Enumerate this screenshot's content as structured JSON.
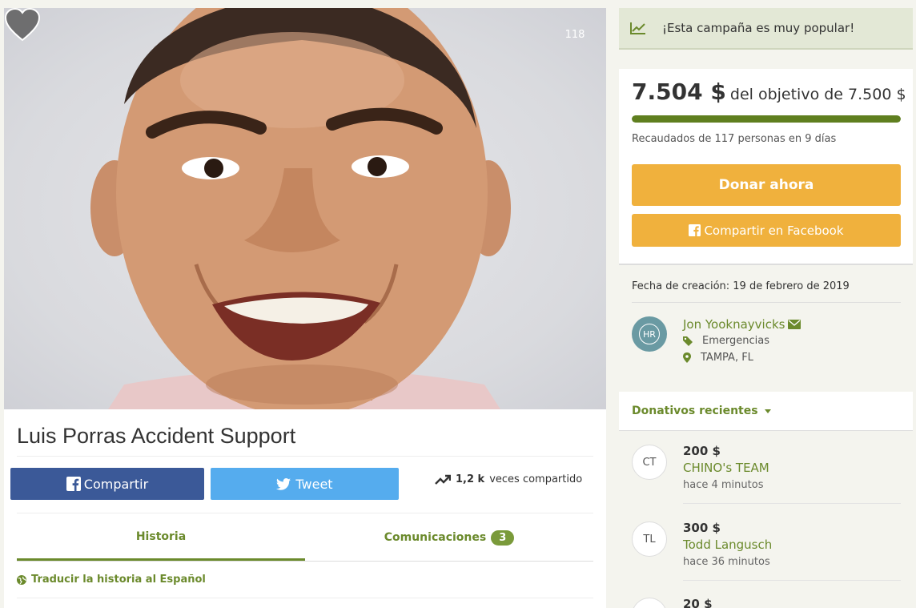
{
  "campaign": {
    "title": "Luis Porras Accident Support",
    "hearts": "118"
  },
  "share": {
    "facebook_label": "Compartir",
    "tweet_label": "Tweet",
    "shared_count": "1,2 k",
    "shared_label": "veces compartido"
  },
  "tabs": {
    "history": "Historia",
    "updates": "Comunicaciones",
    "updates_count": "3",
    "translate": "Traducir la historia al Español"
  },
  "popular": {
    "text": "¡Esta campaña es muy popular!"
  },
  "funding": {
    "raised": "7.504 $",
    "goal": "del objetivo de 7.500 $",
    "progress_fraction": 1.0,
    "meta": "Recaudados de 117 personas en 9 días",
    "donate_label": "Donar ahora",
    "share_fb_label": "Compartir en Facebook"
  },
  "details": {
    "created": "Fecha de creación: 19 de febrero de 2019",
    "organizer_initials": "HR",
    "organizer_name": "Jon Yooknayvicks",
    "category": "Emergencias",
    "location": "TAMPA, FL"
  },
  "donations": {
    "heading": "Donativos recientes",
    "items": [
      {
        "initials": "CT",
        "amount": "200 $",
        "name": "CHINO's TEAM",
        "time": "hace 4 minutos"
      },
      {
        "initials": "TL",
        "amount": "300 $",
        "name": "Todd Langusch",
        "time": "hace 36 minutos"
      },
      {
        "initials": "",
        "amount": "20 $",
        "name": "",
        "time": ""
      }
    ]
  },
  "colors": {
    "accent_green": "#6b8a2c",
    "progress_green": "#5f7f1f",
    "donate_orange": "#f0b13d",
    "facebook_blue": "#3b5998",
    "twitter_blue": "#55acee"
  }
}
